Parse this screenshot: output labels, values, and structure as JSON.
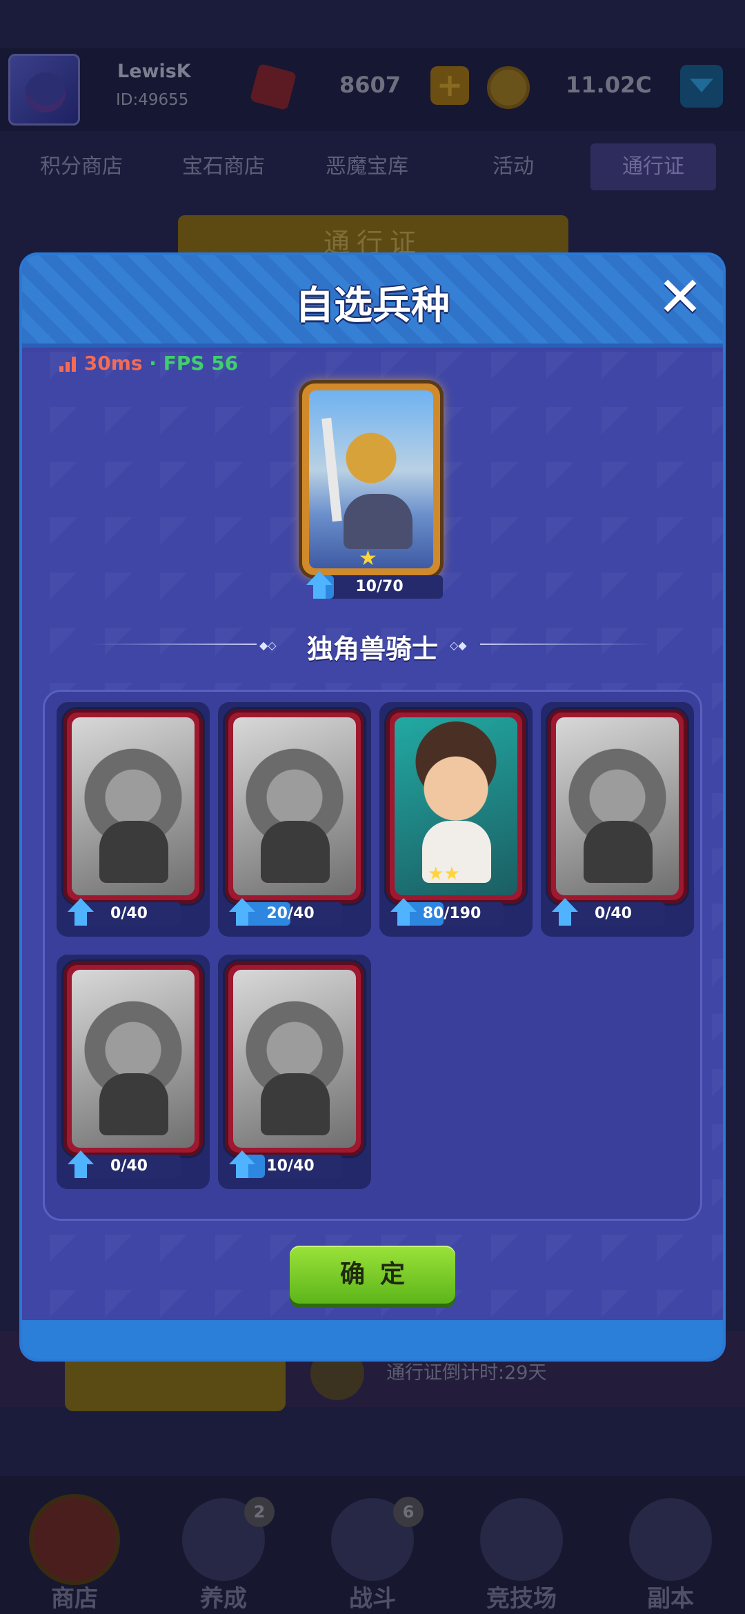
{
  "player": {
    "name": "LewisK",
    "id": "ID:49655"
  },
  "currency": {
    "gems": "8607",
    "coins": "11.02C"
  },
  "shop_tabs": [
    "积分商店",
    "宝石商店",
    "恶魔宝库",
    "活动",
    "通行证"
  ],
  "active_tab": "通行证",
  "banner": "通行证",
  "pass_timer": "通行证倒计时:29天",
  "bottom_nav": [
    {
      "label": "商店",
      "badge": ""
    },
    {
      "label": "养成",
      "badge": "2"
    },
    {
      "label": "战斗",
      "badge": "6"
    },
    {
      "label": "竞技场",
      "badge": ""
    },
    {
      "label": "副本",
      "badge": ""
    }
  ],
  "modal": {
    "title": "自选兵种",
    "close_label": "✕",
    "confirm_label": "确定"
  },
  "net": {
    "ping": "30ms",
    "separator": " · ",
    "fps": "FPS 56"
  },
  "selected_unit": {
    "name": "独角兽骑士",
    "progress_text": "10/70",
    "progress": 0.143,
    "stars": 1
  },
  "units": [
    {
      "progress_text": "0/40",
      "progress": 0.0,
      "unlocked": false,
      "stars": 0
    },
    {
      "progress_text": "20/40",
      "progress": 0.5,
      "unlocked": false,
      "stars": 0
    },
    {
      "progress_text": "80/190",
      "progress": 0.42,
      "unlocked": true,
      "stars": 2
    },
    {
      "progress_text": "0/40",
      "progress": 0.0,
      "unlocked": false,
      "stars": 0
    },
    {
      "progress_text": "0/40",
      "progress": 0.0,
      "unlocked": false,
      "stars": 0
    },
    {
      "progress_text": "10/40",
      "progress": 0.25,
      "unlocked": false,
      "stars": 0
    }
  ],
  "colors": {
    "accent_blue": "#2d86e0",
    "confirm_green": "#7ccb29",
    "frame_red": "#9e1830",
    "ping_red": "#f46b53",
    "fps_green": "#3fd06b"
  }
}
